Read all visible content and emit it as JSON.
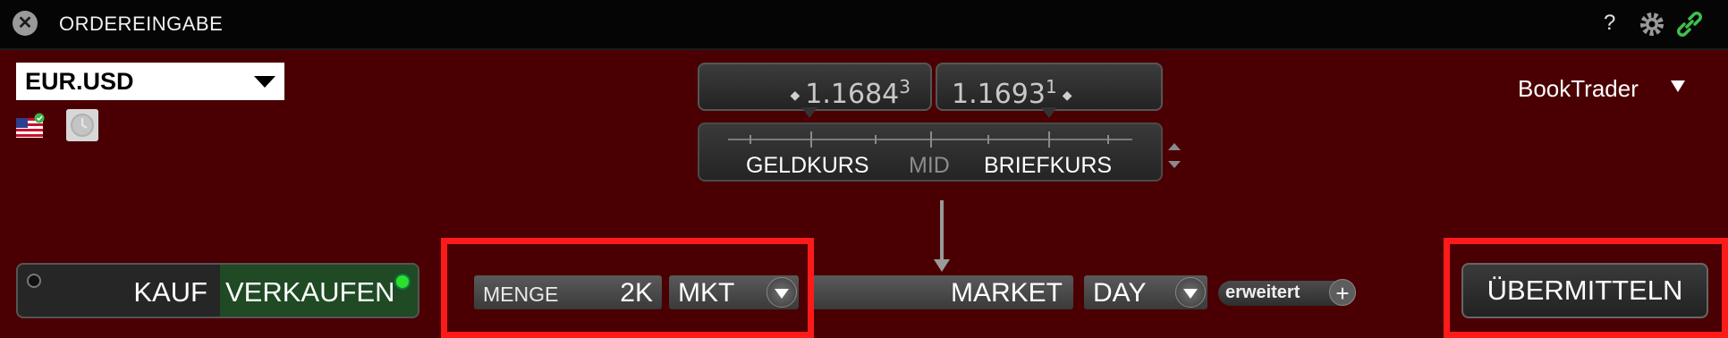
{
  "window": {
    "title": "ORDEREINGABE"
  },
  "titlebar": {
    "help": "?"
  },
  "instrument": {
    "symbol": "EUR.USD"
  },
  "quotes": {
    "bid_main": "1.1684",
    "bid_pip": "3",
    "ask_main": "1.1693",
    "ask_pip": "1"
  },
  "scale": {
    "bid_label": "GELDKURS",
    "mid_label": "MID",
    "ask_label": "BRIEFKURS"
  },
  "book": {
    "label": "BookTrader"
  },
  "side": {
    "buy": "KAUF",
    "sell": "VERKAUFEN",
    "selected": "VERKAUFEN"
  },
  "quantity": {
    "label": "MENGE",
    "value": "2K"
  },
  "order": {
    "type": "MKT",
    "type_long": "MARKET",
    "tif": "DAY",
    "advanced": "erweitert"
  },
  "submit": {
    "label": "ÜBERMITTELN"
  },
  "colors": {
    "background": "#4a0002",
    "highlight": "#ff1a1a",
    "sell_active": "#1f4a24",
    "link": "#3fbf4a"
  }
}
